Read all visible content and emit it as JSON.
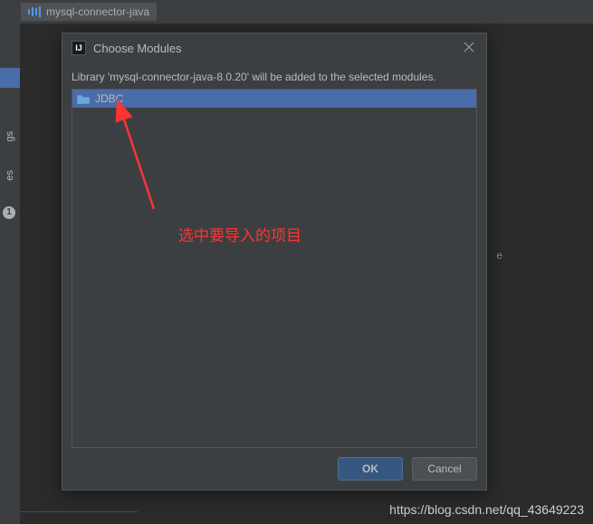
{
  "background": {
    "tab_label": "mysql-connector-java",
    "sidebar_text_1": "gs",
    "sidebar_text_2": "es",
    "sidebar_badge": "1",
    "side_text": "e"
  },
  "dialog": {
    "title": "Choose Modules",
    "icon_text": "IJ",
    "message": "Library 'mysql-connector-java-8.0.20' will be added to the selected modules.",
    "modules": [
      {
        "label": "JDBC"
      }
    ],
    "ok_label": "OK",
    "cancel_label": "Cancel"
  },
  "annotation": {
    "text": "选中要导入的项目"
  },
  "watermark": "https://blog.csdn.net/qq_43649223"
}
